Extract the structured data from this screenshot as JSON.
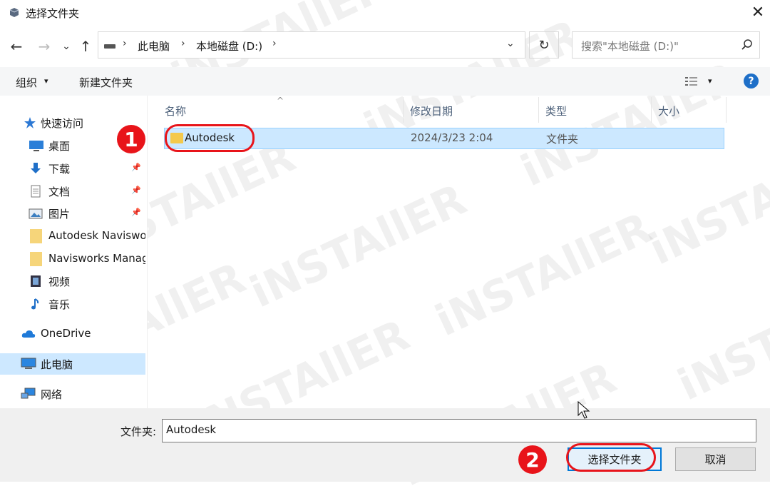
{
  "window": {
    "title": "选择文件夹",
    "close": "✕"
  },
  "nav": {
    "back": "←",
    "forward": "→",
    "recent": "⌄",
    "up": "↑",
    "refresh": "↻",
    "dropdown": "⌄"
  },
  "address": {
    "sep": "›",
    "segments": [
      "此电脑",
      "本地磁盘 (D:)"
    ]
  },
  "search": {
    "placeholder": "搜索\"本地磁盘 (D:)\""
  },
  "toolbar": {
    "organize": "组织",
    "organize_caret": "▾",
    "new_folder": "新建文件夹",
    "view_caret": "▾",
    "help": "?"
  },
  "sidebar": {
    "items": [
      {
        "label": "快速访问",
        "icon": "star-icon"
      },
      {
        "label": "桌面",
        "icon": "desktop-icon"
      },
      {
        "label": "下载",
        "icon": "download-icon",
        "pinned": true
      },
      {
        "label": "文档",
        "icon": "document-icon",
        "pinned": true
      },
      {
        "label": "图片",
        "icon": "picture-icon",
        "pinned": true
      },
      {
        "label": "Autodesk Navisworks",
        "icon": "folder-icon"
      },
      {
        "label": "Navisworks Manage",
        "icon": "folder-icon"
      },
      {
        "label": "视频",
        "icon": "video-icon"
      },
      {
        "label": "音乐",
        "icon": "music-icon"
      },
      {
        "label": "OneDrive",
        "icon": "cloud-icon"
      },
      {
        "label": "此电脑",
        "icon": "computer-icon",
        "selected": true
      },
      {
        "label": "网络",
        "icon": "network-icon"
      }
    ],
    "pin_glyph": "📌"
  },
  "columns": {
    "name": "名称",
    "modified": "修改日期",
    "type": "类型",
    "size": "大小",
    "sort_indicator": "^"
  },
  "files": [
    {
      "name": "Autodesk",
      "modified": "2024/3/23 2:04",
      "type": "文件夹",
      "selected": true
    }
  ],
  "bottom": {
    "folder_label": "文件夹:",
    "folder_value": "Autodesk",
    "select_button": "选择文件夹",
    "cancel_button": "取消"
  },
  "annotations": {
    "step1": "1",
    "step2": "2",
    "accent": "#e8141a"
  },
  "watermark": "iNSTAllER"
}
